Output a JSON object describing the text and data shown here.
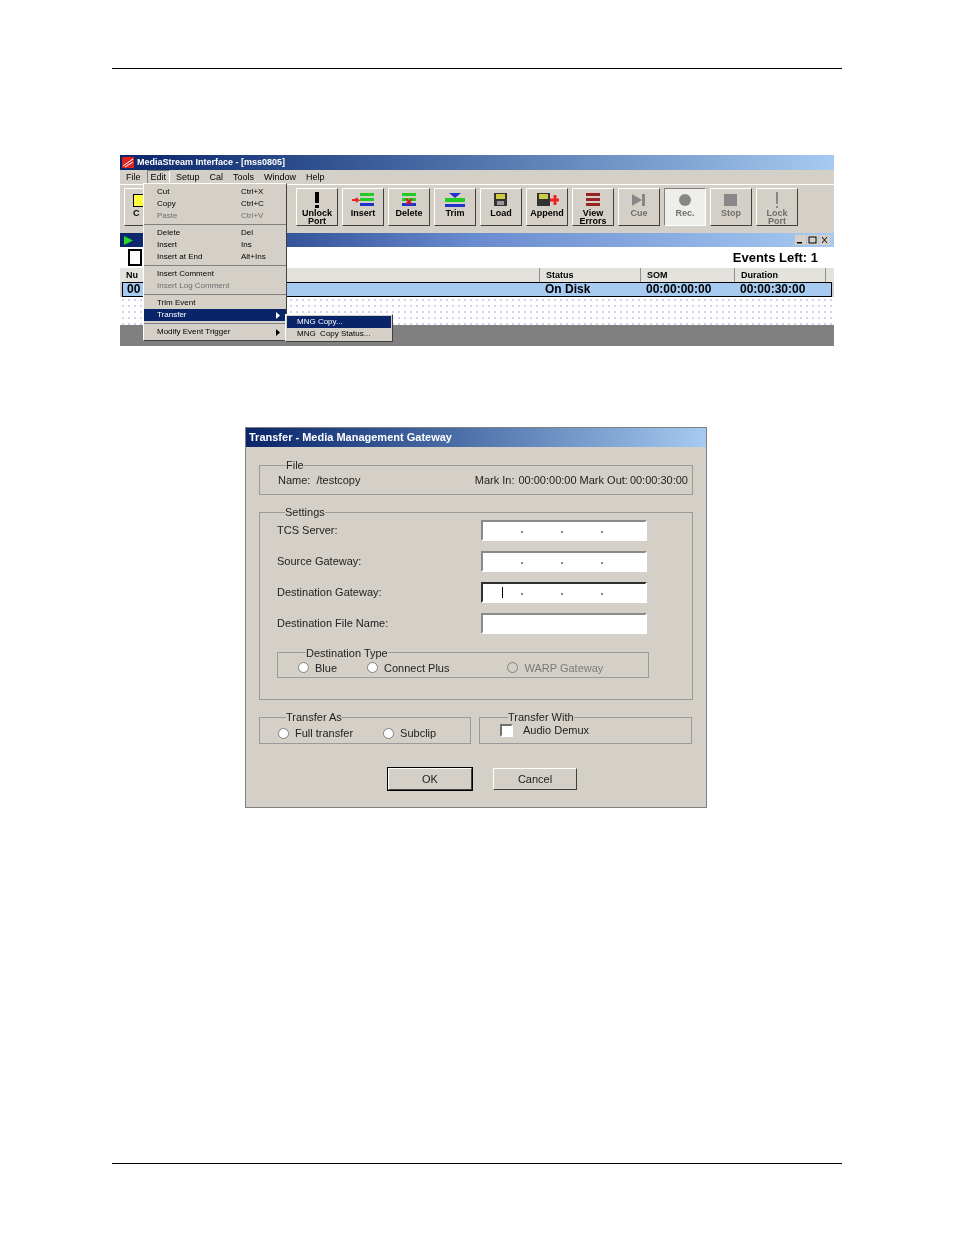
{
  "app": {
    "title": "MediaStream Interface - [mss0805]",
    "menu": [
      {
        "label": "File",
        "selected": false
      },
      {
        "label": "Edit",
        "selected": true
      },
      {
        "label": "Setup",
        "selected": false
      },
      {
        "label": "Cal",
        "selected": false
      },
      {
        "label": "Tools",
        "selected": false
      },
      {
        "label": "Window",
        "selected": false
      },
      {
        "label": "Help",
        "selected": false
      }
    ],
    "toolbar": [
      {
        "label": "C",
        "kind": "folder",
        "disabled": false,
        "pressed": false
      },
      {
        "label": "Unlock Port",
        "kind": "unlock",
        "disabled": false,
        "pressed": false
      },
      {
        "label": "Insert",
        "kind": "insert",
        "disabled": false,
        "pressed": false
      },
      {
        "label": "Delete",
        "kind": "delete",
        "disabled": false,
        "pressed": false
      },
      {
        "label": "Trim",
        "kind": "trim",
        "disabled": false,
        "pressed": false
      },
      {
        "label": "Load",
        "kind": "load",
        "disabled": false,
        "pressed": false
      },
      {
        "label": "Append",
        "kind": "append",
        "disabled": false,
        "pressed": false
      },
      {
        "label": "View Errors",
        "kind": "errors",
        "disabled": false,
        "pressed": false
      },
      {
        "label": "Cue",
        "kind": "cue",
        "disabled": true,
        "pressed": false
      },
      {
        "label": "Rec.",
        "kind": "rec",
        "disabled": true,
        "pressed": true
      },
      {
        "label": "Stop",
        "kind": "stop",
        "disabled": true,
        "pressed": false
      },
      {
        "label": "Lock Port",
        "kind": "lock",
        "disabled": true,
        "pressed": false
      }
    ],
    "events_left": "Events Left: 1",
    "columns": [
      "Nu",
      "Status",
      "SOM",
      "Duration"
    ],
    "rows": [
      {
        "cells": [
          "00",
          "On Disk",
          "00:00:00:00",
          "00:00:30:00"
        ],
        "selected": true
      }
    ],
    "edit_menu": [
      [
        {
          "label": "Cut",
          "shortcut": "Ctrl+X",
          "disabled": false,
          "selected": false,
          "submenu": false
        },
        {
          "label": "Copy",
          "shortcut": "Ctrl+C",
          "disabled": false,
          "selected": false,
          "submenu": false
        },
        {
          "label": "Paste",
          "shortcut": "Ctrl+V",
          "disabled": true,
          "selected": false,
          "submenu": false
        }
      ],
      [
        {
          "label": "Delete",
          "shortcut": "Del",
          "disabled": false,
          "selected": false,
          "submenu": false
        },
        {
          "label": "Insert",
          "shortcut": "Ins",
          "disabled": false,
          "selected": false,
          "submenu": false
        },
        {
          "label": "Insert at End",
          "shortcut": "Alt+Ins",
          "disabled": false,
          "selected": false,
          "submenu": false
        }
      ],
      [
        {
          "label": "Insert Comment",
          "disabled": false,
          "selected": false,
          "submenu": false
        },
        {
          "label": "Insert Log Comment",
          "disabled": true,
          "selected": false,
          "submenu": false
        }
      ],
      [
        {
          "label": "Trim Event",
          "disabled": false,
          "selected": false,
          "submenu": false
        },
        {
          "label": "Transfer",
          "disabled": false,
          "selected": true,
          "submenu": true
        }
      ],
      [
        {
          "label": "Modify Event Trigger",
          "disabled": false,
          "selected": false,
          "submenu": true
        }
      ]
    ],
    "transfer_submenu": [
      {
        "label": "MNG Copy...",
        "selected": true
      },
      {
        "label": "MNG  Copy Status...",
        "selected": false
      }
    ]
  },
  "dialog": {
    "title": "Transfer - Media Management Gateway",
    "file": {
      "legend": "File",
      "name_label": "Name:",
      "name": "/testcopy",
      "mark_in_label": "Mark In:",
      "mark_in": "00:00:00:00",
      "mark_out_label": "Mark Out:",
      "mark_out": "00:00:30:00"
    },
    "settings": {
      "legend": "Settings",
      "fields": [
        {
          "label": "TCS Server:",
          "kind": "ip",
          "focused": false
        },
        {
          "label": "Source Gateway:",
          "kind": "ip",
          "focused": false
        },
        {
          "label": "Destination Gateway:",
          "kind": "ip",
          "focused": true
        },
        {
          "label": "Destination File Name:",
          "kind": "text",
          "focused": false
        }
      ],
      "destination_type": {
        "legend": "Destination Type",
        "options": [
          {
            "label": "Blue",
            "selected": false,
            "disabled": false
          },
          {
            "label": "Connect Plus",
            "selected": false,
            "disabled": false
          },
          {
            "label": "WARP Gateway",
            "selected": false,
            "disabled": true
          }
        ]
      }
    },
    "transfer_as": {
      "legend": "Transfer As",
      "options": [
        {
          "label": "Full transfer",
          "selected": false,
          "disabled": false
        },
        {
          "label": "Subclip",
          "selected": false,
          "disabled": false
        }
      ]
    },
    "transfer_with": {
      "legend": "Transfer With",
      "options": [
        {
          "label": "Audio Demux",
          "checked": false
        }
      ]
    },
    "buttons": [
      {
        "label": "OK",
        "default": true
      },
      {
        "label": "Cancel",
        "default": false
      }
    ]
  }
}
